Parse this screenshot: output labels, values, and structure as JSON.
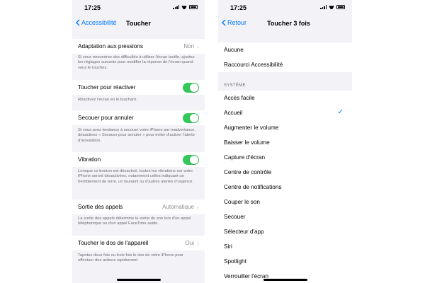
{
  "left": {
    "time": "17:25",
    "back_label": "Accessibilité",
    "title": "Toucher",
    "rows": {
      "adaptation": {
        "label": "Adaptation aux pressions",
        "value": "Non"
      },
      "reactivate": {
        "label": "Toucher pour réactiver"
      },
      "shake": {
        "label": "Secouer pour annuler"
      },
      "vibration": {
        "label": "Vibration"
      },
      "calls": {
        "label": "Sortie des appels",
        "value": "Automatique"
      },
      "backtap": {
        "label": "Toucher le dos de l'appareil",
        "value": "Oui"
      }
    },
    "footers": {
      "adaptation": "Si vous rencontrez des difficultés à utiliser l'écran tactile, ajustez les réglages suivants pour modifier la réponse de l'écran quand vous le touchez.",
      "reactivate": "Réactivez l'écran en le touchant.",
      "shake": "Si vous avez tendance à secouer votre iPhone par inadvertance, désactivez « Secouer pour annuler » pour éviter d'activer l'alerte d'annulation.",
      "vibration": "Lorsque ce bouton est désactivé, toutes les vibrations sur votre iPhone seront désactivées, notamment celles indiquant un tremblement de terre, un tsunami ou d'autres alertes d'urgence.",
      "calls": "La sortie des appels détermine la sortie du son lors d'un appel téléphonique ou d'un appel FaceTime audio.",
      "backtap": "Tapotez deux fois ou trois fois le dos de votre iPhone pour effectuer des actions rapidement."
    }
  },
  "right": {
    "time": "17:25",
    "back_label": "Retour",
    "title": "Toucher 3 fois",
    "top_items": [
      "Aucune",
      "Raccourci Accessibilité"
    ],
    "section_header": "SYSTÈME",
    "system_items": [
      "Accès facile",
      "Accueil",
      "Augmenter le volume",
      "Baisser le volume",
      "Capture d'écran",
      "Centre de contrôle",
      "Centre de notifications",
      "Couper le son",
      "Secouer",
      "Sélecteur d'app",
      "Siri",
      "Spotlight",
      "Verrouiller l'écran"
    ],
    "selected": "Accueil"
  },
  "colors": {
    "accent": "#007aff",
    "toggle_on": "#34c759",
    "grouped_bg": "#f2f2f7"
  },
  "icons": [
    "chevron-left-icon",
    "chevron-right-icon",
    "checkmark-icon",
    "wifi-icon",
    "battery-icon",
    "signal-icon"
  ]
}
